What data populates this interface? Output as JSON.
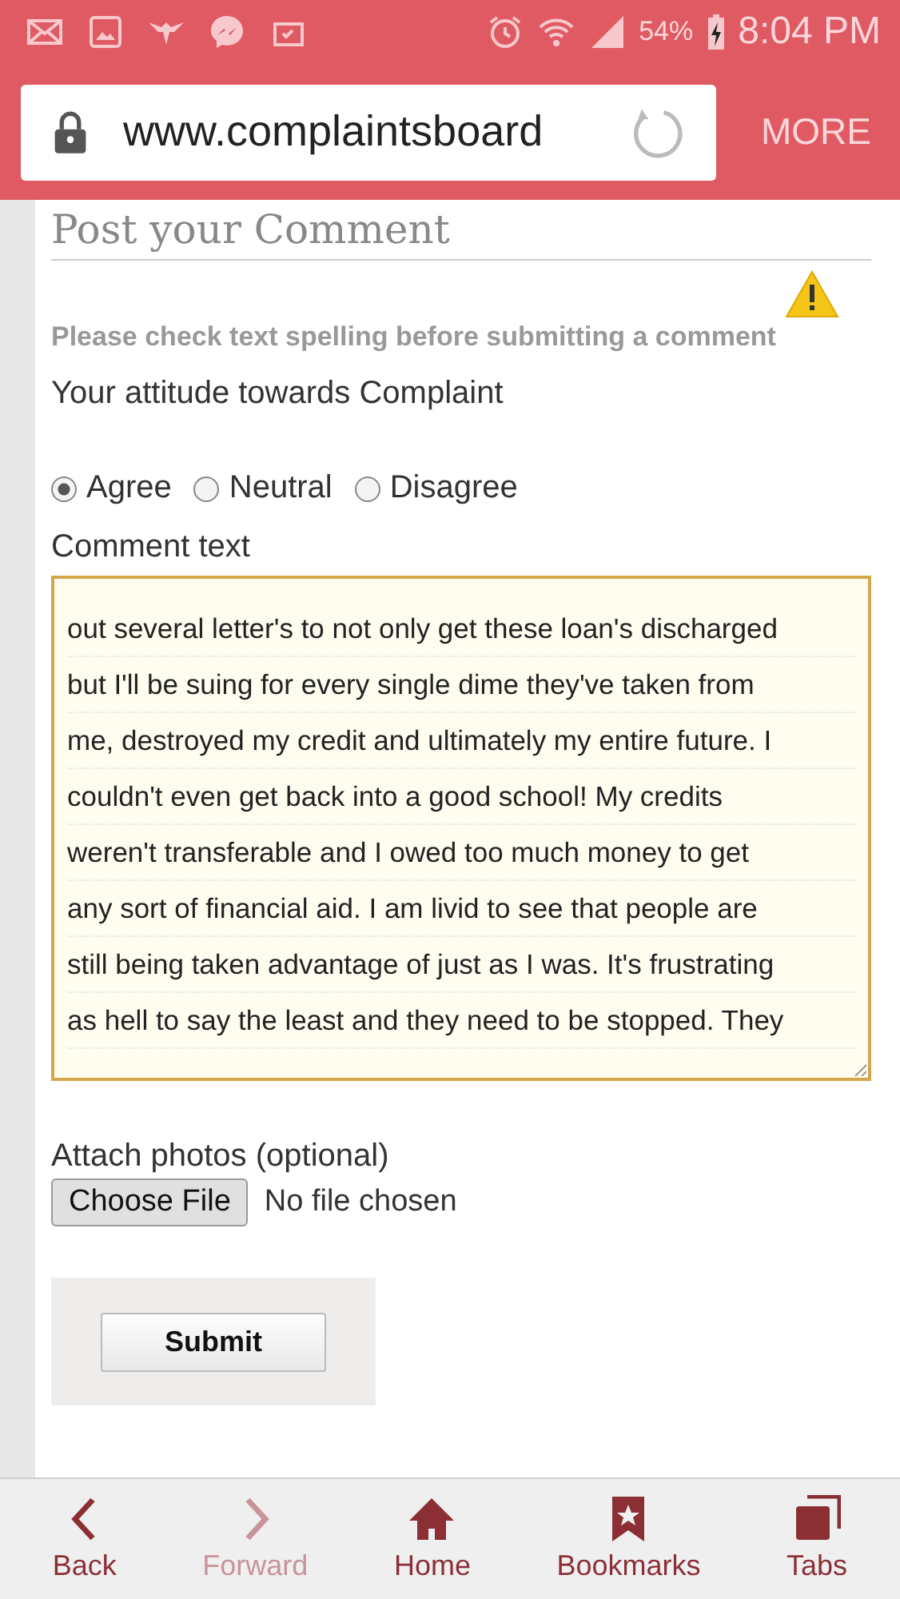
{
  "status_bar": {
    "battery": "54%",
    "time": "8:04 PM"
  },
  "browser": {
    "url": "www.complaintsboard",
    "more": "MORE"
  },
  "form": {
    "title": "Post your Comment",
    "warning": "Please check text spelling before submitting a comment",
    "attitude_label": "Your attitude towards Complaint",
    "attitudes": [
      {
        "label": "Agree",
        "selected": true
      },
      {
        "label": "Neutral",
        "selected": false
      },
      {
        "label": "Disagree",
        "selected": false
      }
    ],
    "comment_label": "Comment text",
    "comment_lines": [
      "out several letter's to not only get these loan's discharged",
      "but I'll be suing for every single dime they've taken from",
      "me, destroyed my credit and ultimately my entire future. I",
      "couldn't even get back into a good school! My credits",
      "weren't transferable and I owed too much money to get",
      "any sort of financial aid. I am livid to see that people are",
      "still being taken advantage of just as I was. It's frustrating",
      "as hell to say the least and they need to be stopped. They"
    ],
    "attach_label": "Attach photos (optional)",
    "choose_file": "Choose File",
    "file_status": "No file chosen",
    "submit": "Submit"
  },
  "bottom_nav": [
    {
      "kind": "back",
      "label": "Back",
      "disabled": false
    },
    {
      "kind": "forward",
      "label": "Forward",
      "disabled": true
    },
    {
      "kind": "home",
      "label": "Home",
      "disabled": false
    },
    {
      "kind": "bookmarks",
      "label": "Bookmarks",
      "disabled": false
    },
    {
      "kind": "tabs",
      "label": "Tabs",
      "disabled": false
    }
  ]
}
